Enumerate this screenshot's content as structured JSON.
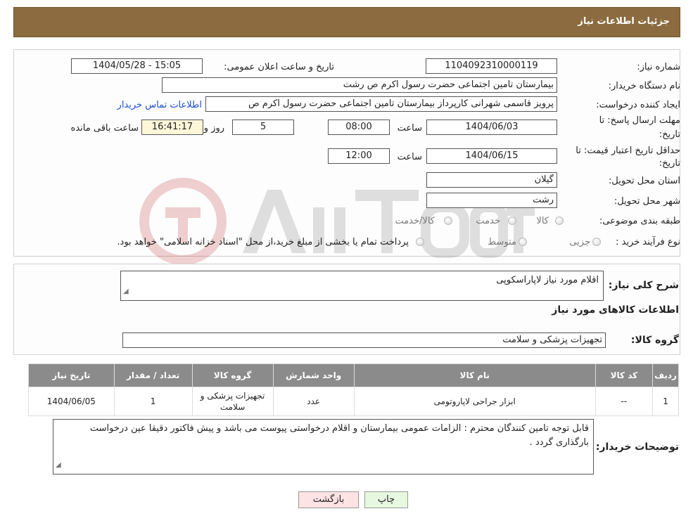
{
  "header": {
    "title": "جزئیات اطلاعات نیاز"
  },
  "form": {
    "need_number_label": "شماره نیاز:",
    "need_number": "1104092310000119",
    "announce_label": "تاریخ و ساعت اعلان عمومی:",
    "announce_value": "1404/05/28 - 15:05",
    "buyer_org_label": "نام دستگاه خریدار:",
    "buyer_org": "بیمارستان  تامین اجتماعی حضرت رسول اکرم ص رشت",
    "requester_label": "ایجاد کننده درخواست:",
    "requester": "پرویز قاسمی شهرانی کارپرداز بیمارستان  تامین اجتماعی حضرت رسول اکرم ص",
    "contact_link": "اطلاعات تماس خریدار",
    "deadline_label_1": "مهلت ارسال پاسخ: تا",
    "deadline_label_2": "تاریخ:",
    "deadline_date": "1404/06/03",
    "time_label": "ساعت",
    "deadline_time": "08:00",
    "days_value": "5",
    "days_label": "روز و",
    "remaining_time": "16:41:17",
    "remaining_label": "ساعت باقی مانده",
    "validity_label_1": "حداقل تاریخ اعتبار قیمت: تا",
    "validity_label_2": "تاریخ:",
    "validity_date": "1404/06/15",
    "validity_time": "12:00",
    "province_label": "استان محل تحویل:",
    "province": "گیلان",
    "city_label": "شهر محل تحویل:",
    "city": "رشت",
    "category_label": "طبقه بندی موضوعی:",
    "category_options": [
      "کالا",
      "خدمت",
      "کالا/خدمت"
    ],
    "process_label": "نوع فرآیند خرید :",
    "process_options": [
      "جزیی",
      "متوسط"
    ],
    "process_note": "پرداخت تمام یا بخشی از مبلغ خرید،از محل \"اسناد خزانه اسلامی\" خواهد بود."
  },
  "summary": {
    "label": "شرح کلی نیاز:",
    "value": "اقلام مورد نیاز لاپاراسکوپی",
    "goods_info_title": "اطلاعات کالاهای مورد نیاز",
    "group_label": "گروه کالا:",
    "group_value": "تجهیزات پزشکی و سلامت"
  },
  "table": {
    "headers": [
      "ردیف",
      "کد کالا",
      "نام کالا",
      "واحد شمارش",
      "گروه کالا",
      "تعداد / مقدار",
      "تاریخ نیاز"
    ],
    "rows": [
      [
        "1",
        "--",
        "ابزار جراحی لاپاروتومی",
        "عدد",
        "تجهیزات پزشکی و سلامت",
        "1",
        "1404/06/05"
      ]
    ]
  },
  "notes": {
    "label": "توضیحات خریدار:",
    "value": "قابل توجه  تامین کنندگان محترم : الزامات عمومی بیمارستان و اقلام درخواستی پیوست می باشد و پیش فاکتور دقیقا عین درخواست بارگذاری گردد ."
  },
  "buttons": {
    "print": "چاپ",
    "back": "بازگشت"
  },
  "colors": {
    "header_bg": "#8b6b3f",
    "table_header_bg": "#8b8b8b",
    "link": "#1a4fd1"
  }
}
